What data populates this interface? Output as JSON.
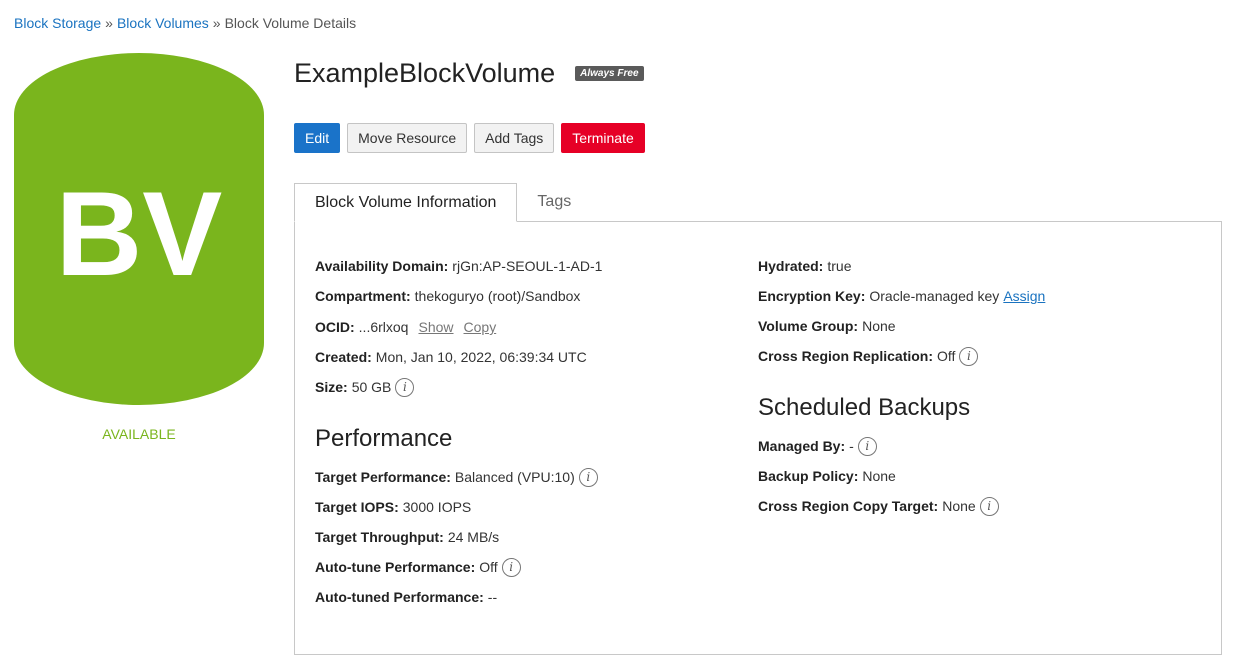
{
  "breadcrumb": {
    "items": [
      "Block Storage",
      "Block Volumes"
    ],
    "separator": "»",
    "current": "Block Volume Details"
  },
  "hero": {
    "initials": "BV",
    "color": "#7ab51d",
    "status": "AVAILABLE"
  },
  "header": {
    "title": "ExampleBlockVolume",
    "badge": "Always Free"
  },
  "actions": {
    "edit": "Edit",
    "move": "Move Resource",
    "tags": "Add Tags",
    "terminate": "Terminate"
  },
  "tabs": {
    "info": "Block Volume Information",
    "tags": "Tags"
  },
  "info": {
    "availability_domain": {
      "label": "Availability Domain:",
      "value": "rjGn:AP-SEOUL-1-AD-1"
    },
    "compartment": {
      "label": "Compartment:",
      "value": "thekoguryo (root)/Sandbox"
    },
    "ocid": {
      "label": "OCID:",
      "value": "...6rlxoq",
      "show": "Show",
      "copy": "Copy"
    },
    "created": {
      "label": "Created:",
      "value": "Mon, Jan 10, 2022, 06:39:34 UTC"
    },
    "size": {
      "label": "Size:",
      "value": "50 GB"
    },
    "hydrated": {
      "label": "Hydrated:",
      "value": "true"
    },
    "encryption": {
      "label": "Encryption Key:",
      "value": "Oracle-managed key",
      "link": "Assign"
    },
    "volume_group": {
      "label": "Volume Group:",
      "value": "None"
    },
    "cross_region_replication": {
      "label": "Cross Region Replication:",
      "value": "Off"
    }
  },
  "performance": {
    "title": "Performance",
    "target_performance": {
      "label": "Target Performance:",
      "value": "Balanced (VPU:10)"
    },
    "target_iops": {
      "label": "Target IOPS:",
      "value": "3000 IOPS"
    },
    "target_throughput": {
      "label": "Target Throughput:",
      "value": "24 MB/s"
    },
    "auto_tune": {
      "label": "Auto-tune Performance:",
      "value": "Off"
    },
    "auto_tuned": {
      "label": "Auto-tuned Performance:",
      "value": "--"
    }
  },
  "backups": {
    "title": "Scheduled Backups",
    "managed_by": {
      "label": "Managed By:",
      "value": "-"
    },
    "backup_policy": {
      "label": "Backup Policy:",
      "value": "None"
    },
    "cross_region_copy": {
      "label": "Cross Region Copy Target:",
      "value": "None"
    }
  },
  "icons": {
    "info": "i"
  }
}
